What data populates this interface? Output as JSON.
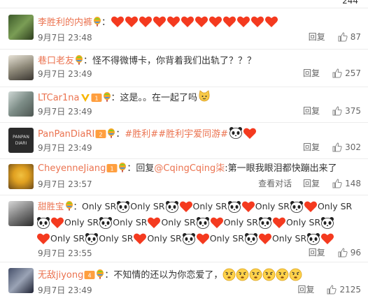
{
  "top": {
    "like_count": "244"
  },
  "comments": [
    {
      "username": "李胜利的内裤",
      "text": "",
      "time": "9月7日 23:48",
      "reply_label": "回复",
      "likes": "87"
    },
    {
      "username": "巷口老友",
      "text": "怪不得微博卡，你背着我们出轨了？？？",
      "time": "9月7日 23:49",
      "reply_label": "回复",
      "likes": "257"
    },
    {
      "username": "LTCar1na",
      "text": "这是。。在一起了吗",
      "time": "9月7日 23:49",
      "reply_label": "回复",
      "likes": "375"
    },
    {
      "username": "PanPanDiaRI",
      "topics": [
        "#胜利#",
        "#胜利宇爱同游#"
      ],
      "time": "9月7日 23:49",
      "reply_label": "回复",
      "likes": "302"
    },
    {
      "username": "CheyenneJiang",
      "reply_prefix": "回复",
      "mention": "@CqingCqing柒",
      "text": ":第一眼我眼泪都快蹦出来了",
      "time": "9月7日 23:57",
      "view_dialog_label": "查看对话",
      "reply_label": "回复",
      "likes": "148"
    },
    {
      "username": "甜胜宝",
      "only": "Only SR",
      "time": "9月7日 23:55",
      "reply_label": "回复",
      "likes": "96"
    },
    {
      "username": "无敌jiyong",
      "text": "不知情的还以为你恋爱了，",
      "time": "9月7日 23:49",
      "reply_label": "回复",
      "likes": "2125"
    }
  ],
  "colors": {
    "username": "#eb7350",
    "meta": "#666666",
    "heart": "#f43a1f"
  }
}
